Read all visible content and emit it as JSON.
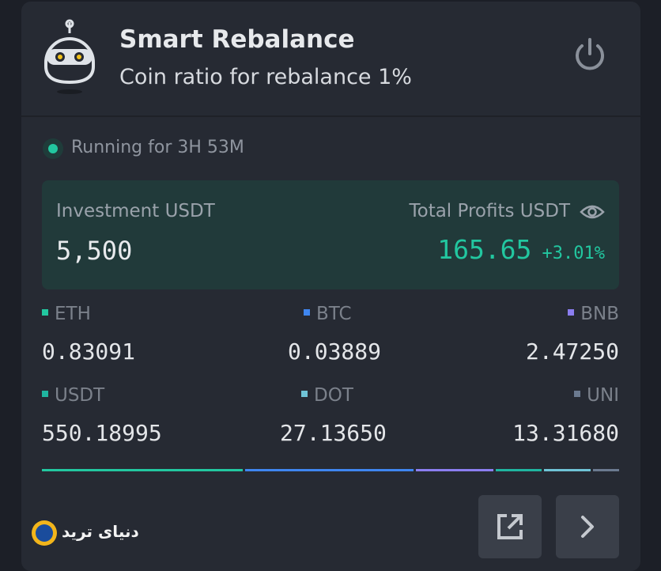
{
  "header": {
    "title": "Smart Rebalance",
    "subtitle": "Coin ratio for rebalance 1%",
    "bot_icon": "robot-icon",
    "power_icon": "power-icon"
  },
  "status": {
    "text": "Running for 3H 53M",
    "color": "#22c7a0"
  },
  "summary": {
    "investment_label": "Investment USDT",
    "investment_value": "5,500",
    "profit_label": "Total Profits USDT",
    "profit_value": "165.65",
    "profit_pct": "+3.01%",
    "eye_icon": "eye-icon"
  },
  "coins": [
    {
      "name": "ETH",
      "amount": "0.83091",
      "color": "#22c7a0"
    },
    {
      "name": "BTC",
      "amount": "0.03889",
      "color": "#3f86f0"
    },
    {
      "name": "BNB",
      "amount": "2.47250",
      "color": "#8b7ef0"
    },
    {
      "name": "USDT",
      "amount": "550.18995",
      "color": "#1fb5a0"
    },
    {
      "name": "DOT",
      "amount": "27.13650",
      "color": "#6fc3d6"
    },
    {
      "name": "UNI",
      "amount": "13.31680",
      "color": "#6b7a90"
    }
  ],
  "actions": {
    "share_icon": "share-icon",
    "details_icon": "chevron-right-icon"
  },
  "watermark": {
    "text": "دنیای ترید"
  }
}
